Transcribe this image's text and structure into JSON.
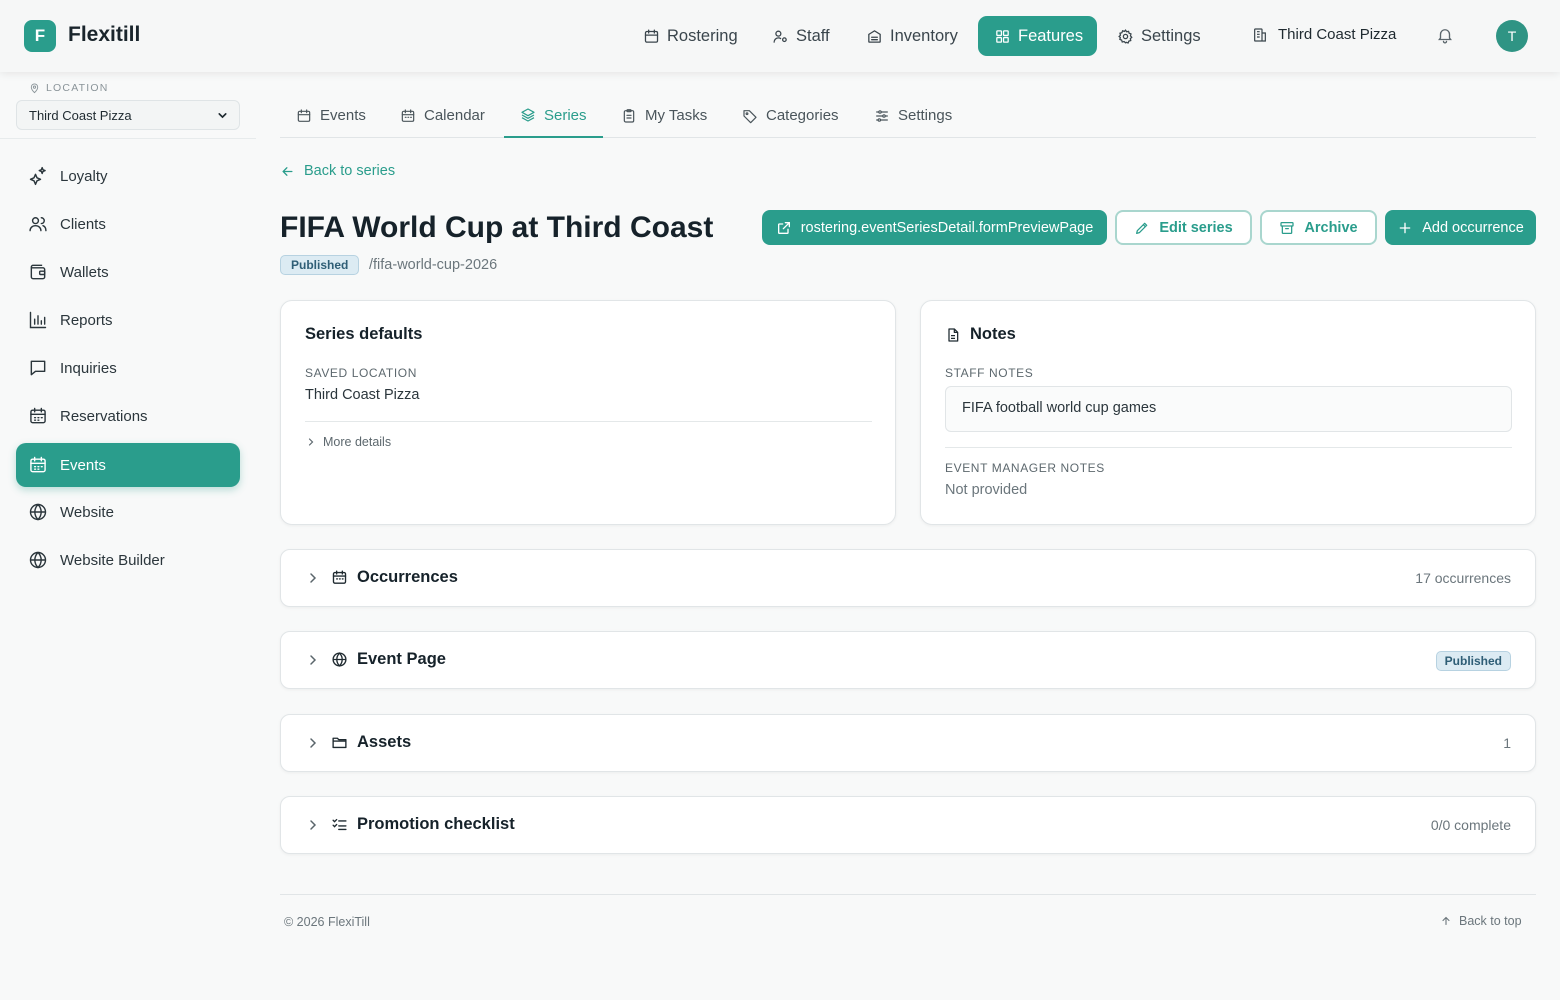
{
  "app": {
    "logo_letter": "F",
    "name": "Flexitill"
  },
  "topnav": {
    "items": [
      {
        "label": "Rostering",
        "icon": "calendar-icon"
      },
      {
        "label": "Staff",
        "icon": "user-cog-icon"
      },
      {
        "label": "Inventory",
        "icon": "archive-box-icon"
      },
      {
        "label": "Features",
        "icon": "grid-icon",
        "active": true
      },
      {
        "label": "Settings",
        "icon": "gear-icon"
      }
    ],
    "location": "Third Coast Pizza",
    "avatar": "T"
  },
  "sidebar": {
    "location_label": "LOCATION",
    "location_value": "Third Coast Pizza",
    "items": [
      {
        "label": "Loyalty",
        "icon": "sparkles-icon"
      },
      {
        "label": "Clients",
        "icon": "users-icon"
      },
      {
        "label": "Wallets",
        "icon": "wallet-icon"
      },
      {
        "label": "Reports",
        "icon": "bar-chart-icon"
      },
      {
        "label": "Inquiries",
        "icon": "message-icon"
      },
      {
        "label": "Reservations",
        "icon": "calendar-icon"
      },
      {
        "label": "Events",
        "icon": "calendar-icon",
        "active": true
      },
      {
        "label": "Website",
        "icon": "globe-icon"
      },
      {
        "label": "Website Builder",
        "icon": "globe-icon"
      }
    ]
  },
  "tabs": [
    {
      "label": "Events",
      "icon": "calendar-icon"
    },
    {
      "label": "Calendar",
      "icon": "calendar-icon"
    },
    {
      "label": "Series",
      "icon": "layers-icon",
      "active": true
    },
    {
      "label": "My Tasks",
      "icon": "clipboard-icon"
    },
    {
      "label": "Categories",
      "icon": "tag-icon"
    },
    {
      "label": "Settings",
      "icon": "sliders-icon"
    }
  ],
  "page": {
    "back_label": "Back to series",
    "title": "FIFA World Cup at Third Coast",
    "status": "Published",
    "slug": "/fifa-world-cup-2026",
    "actions": {
      "preview": "rostering.eventSeriesDetail.formPreviewPage",
      "edit": "Edit series",
      "archive": "Archive",
      "add": "Add occurrence"
    }
  },
  "defaults_card": {
    "title": "Series defaults",
    "saved_location_label": "SAVED LOCATION",
    "saved_location_value": "Third Coast Pizza",
    "more_details": "More details"
  },
  "notes_card": {
    "title": "Notes",
    "staff_notes_label": "STAFF NOTES",
    "staff_notes_value": "FIFA football world cup games",
    "manager_notes_label": "EVENT MANAGER NOTES",
    "manager_notes_value": "Not provided"
  },
  "sections": [
    {
      "title": "Occurrences",
      "icon": "calendar-icon",
      "meta": "17 occurrences"
    },
    {
      "title": "Event Page",
      "icon": "globe-icon",
      "badge": "Published"
    },
    {
      "title": "Assets",
      "icon": "folder-icon",
      "meta": "1"
    },
    {
      "title": "Promotion checklist",
      "icon": "checklist-icon",
      "meta": "0/0 complete"
    }
  ],
  "footer": {
    "copyright": "© 2026 FlexiTill",
    "back_to_top": "Back to top"
  },
  "colors": {
    "accent": "#2a9d8c",
    "badge_bg": "#dcebf3",
    "badge_text": "#2f5e76"
  }
}
